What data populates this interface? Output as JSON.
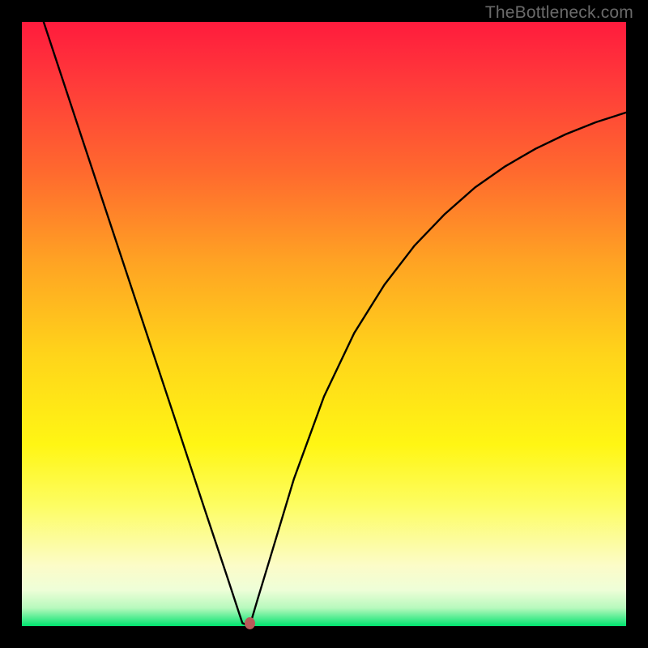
{
  "watermark": "TheBottleneck.com",
  "chart_data": {
    "type": "line",
    "title": "",
    "xlabel": "",
    "ylabel": "",
    "xlim": [
      0,
      100
    ],
    "ylim": [
      0,
      100
    ],
    "background_gradient": {
      "top": "#ff1b3d",
      "middle": "#ffd41a",
      "bottom": "#00e36e"
    },
    "series": [
      {
        "name": "bottleneck-curve",
        "x": [
          3.6,
          10,
          15,
          20,
          25,
          30,
          32,
          34,
          36,
          36.5,
          37.7,
          39,
          41,
          45,
          50,
          55,
          60,
          65,
          70,
          75,
          80,
          85,
          90,
          95,
          100
        ],
        "y": [
          100,
          80.6,
          65.5,
          50.4,
          35.3,
          20.1,
          14.1,
          8.1,
          2.0,
          0.5,
          0.0,
          4.4,
          11.0,
          24.3,
          38.0,
          48.5,
          56.5,
          63.0,
          68.2,
          72.6,
          76.1,
          79.0,
          81.4,
          83.4,
          85.0
        ]
      }
    ],
    "marker": {
      "x": 37.7,
      "y": 0.0,
      "color": "#b95a5a"
    }
  }
}
